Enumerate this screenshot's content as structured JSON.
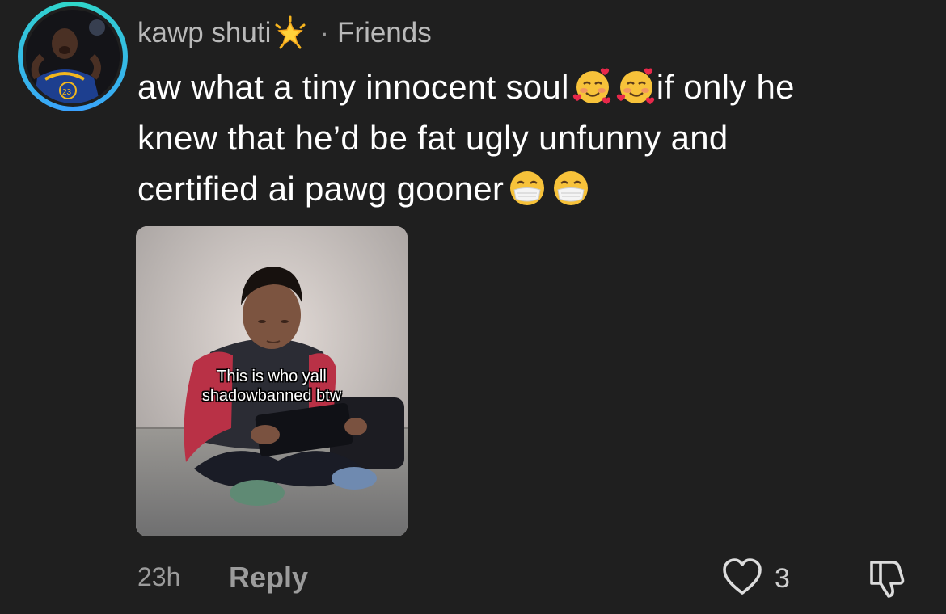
{
  "comment": {
    "username": "kawp shuti",
    "username_badge_icon": "glowing-star-icon",
    "separator": "·",
    "relationship": "Friends",
    "text_lines": [
      "aw what a tiny innocent soul",
      "if only he",
      "knew that he’d be fat ugly unfunny and",
      "certified ai pawg gooner"
    ],
    "emojis": {
      "line1": [
        "smiling-face-with-hearts-icon",
        "smiling-face-with-hearts-icon"
      ],
      "line3": [
        "face-with-medical-mask-icon",
        "face-with-medical-mask-icon"
      ]
    },
    "media": {
      "overlay_lines": [
        "This is who yall",
        "shadowbanned btw"
      ]
    },
    "time": "23h",
    "reply_label": "Reply",
    "like_count": "3"
  },
  "colors": {
    "background": "#1f1f1f",
    "primary_text": "#ffffff",
    "secondary_text": "#9c9c9c",
    "avatar_ring": "#2fd8c8"
  }
}
